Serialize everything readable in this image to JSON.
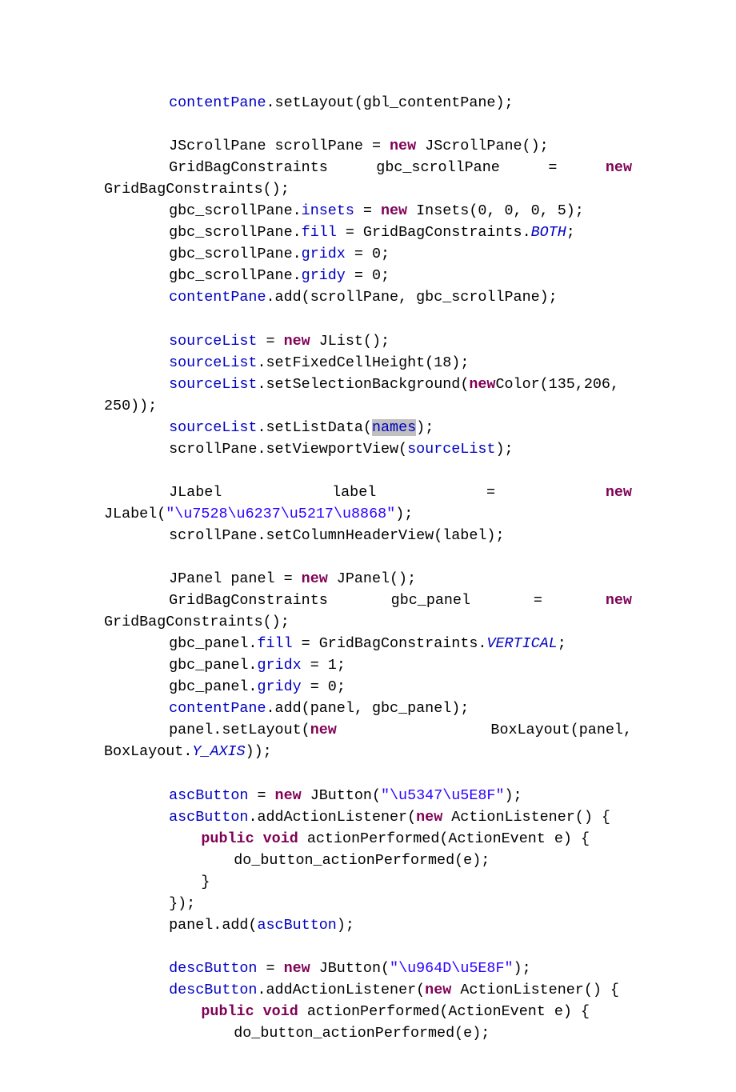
{
  "tokens": {
    "contentPane": "contentPane",
    "setLayout": ".setLayout(gbl_contentPane);",
    "jScrollPaneDecl": "JScrollPane scrollPane = ",
    "new": "new",
    "jScrollPaneEnd": " JScrollPane();",
    "gridBagConstraints": "GridBagConstraints",
    "gbcScrollPane": "gbc_scrollPane",
    "equals": "=",
    "gridBagConstraintsCtor": "GridBagConstraints();",
    "gbcInsets1": "gbc_scrollPane.",
    "insets": "insets",
    "insets2": " = ",
    "insetsCtor": " Insets(0, 0, 0, 5);",
    "gbcFill1": "gbc_scrollPane.",
    "fill": "fill",
    "fill2": " = GridBagConstraints.",
    "BOTH": "BOTH",
    "semi": ";",
    "gbcGridx": "gbc_scrollPane.",
    "gridx": "gridx",
    "gridx2": " = 0;",
    "gbcGridy": "gbc_scrollPane.",
    "gridy": "gridy",
    "gridy2": " = 0;",
    "addScroll": ".add(scrollPane, gbc_scrollPane);",
    "sourceList": "sourceList",
    "eqNewJList": " = ",
    "jListCtor": " JList();",
    "setFixedCell": ".setFixedCellHeight(18);",
    "setSelBg1": ".setSelectionBackground(",
    "color1": "Color(135,206,",
    "color2": "250));",
    "setListData1": ".setListData(",
    "names": "names",
    "closeParenSemi": ");",
    "scrollSetViewport1": "scrollPane.setViewportView(",
    "jlabel": "JLabel",
    "label": "label",
    "jlabelCtor1": "JLabel(",
    "jlabelStr": "\"\\u7528\\u6237\\u5217\\u8868\"",
    "scrollSetColHdr": "scrollPane.setColumnHeaderView(label);",
    "jpanelDecl": "JPanel panel = ",
    "jpanelCtor": " JPanel();",
    "gbcPanel": "gbc_panel",
    "gbcPanelFill1": "gbc_panel.",
    "VERTICAL": "VERTICAL",
    "gbcPanelGridx1": "gbc_panel.",
    "gbcPanelGridx2": " = 1;",
    "gbcPanelGridy1": "gbc_panel.",
    "addPanel": ".add(panel, gbc_panel);",
    "panelSetLayout1": "panel.setLayout(",
    "boxLayout1": "BoxLayout(panel,",
    "boxLayout2": "BoxLayout.",
    "Y_AXIS": "Y_AXIS",
    "boxLayout3": "));",
    "ascButton": "ascButton",
    "jbuttonCtor1": " JButton(",
    "ascStr": "\"\\u5347\\u5E8F\"",
    "addActionListener1": ".addActionListener(",
    "actionListener": " ActionListener() {",
    "publicVoid": "public void",
    "actionPerformed": " actionPerformed(ActionEvent e) {",
    "doButton": "do_button_actionPerformed(e);",
    "closeBrace": "}",
    "closeAnon": "});",
    "panelAdd1": "panel.add(",
    "descButton": "descButton",
    "descStr": "\"\\u964D\\u5E8F\""
  }
}
